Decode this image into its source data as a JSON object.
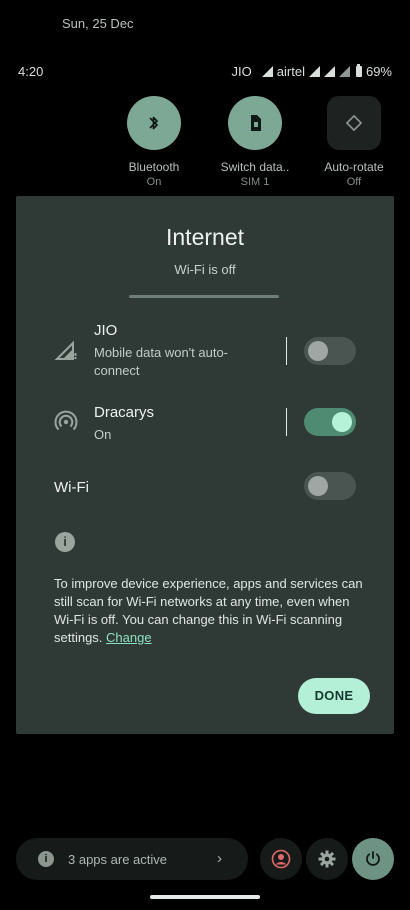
{
  "notification_shade": {
    "date": "Sun, 25 Dec"
  },
  "status_bar": {
    "time": "4:20",
    "carrier1": "JIO",
    "carrier2": "airtel",
    "battery": "69%"
  },
  "quick_tiles": [
    {
      "label": "Bluetooth",
      "state": "On",
      "icon": "bluetooth-icon"
    },
    {
      "label": "Switch data..",
      "state": "SIM 1",
      "icon": "sim-card-icon"
    },
    {
      "label": "Auto-rotate",
      "state": "Off",
      "icon": "rotate-icon"
    }
  ],
  "dialog": {
    "title": "Internet",
    "subtitle": "Wi-Fi is off",
    "networks": [
      {
        "name": "JIO",
        "description": "Mobile data won't auto-connect",
        "enabled": false,
        "icon": "cellular-signal-icon"
      },
      {
        "name": "Dracarys",
        "description": "On",
        "enabled": true,
        "icon": "hotspot-icon"
      }
    ],
    "wifi": {
      "label": "Wi-Fi",
      "enabled": false
    },
    "info_text": "To improve device experience, apps and services can still scan for Wi-Fi networks at any time, even when Wi-Fi is off. You can change this in Wi-Fi scanning settings.",
    "change_link": "Change",
    "done_label": "DONE"
  },
  "footer": {
    "apps_active": "3 apps are active"
  },
  "colors": {
    "accent": "#b4f0d8",
    "dialog_bg": "#2f3a37",
    "toggle_on": "#4f8a73"
  }
}
